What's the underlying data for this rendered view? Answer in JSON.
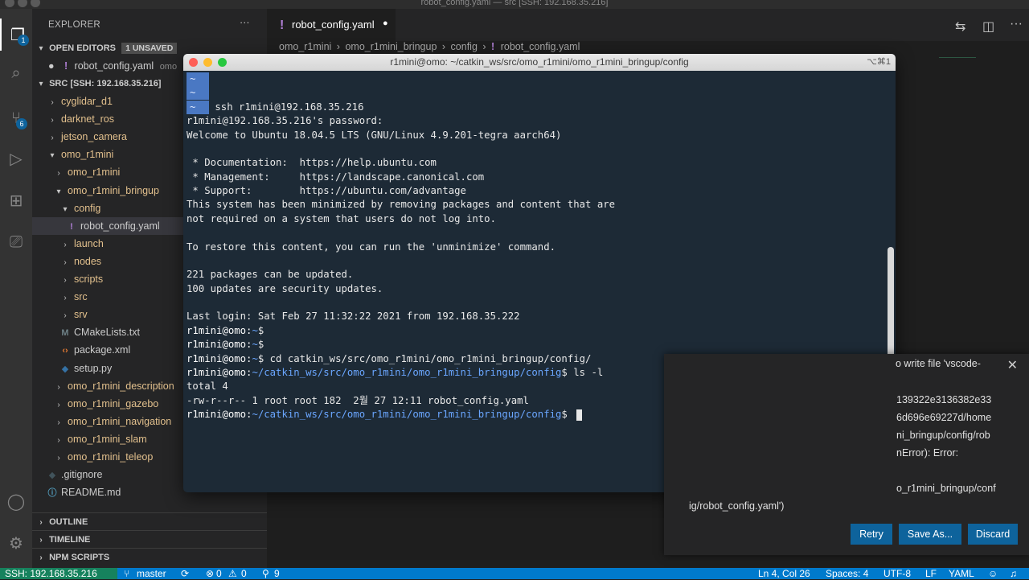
{
  "window_title": "robot_config.yaml — src [SSH: 192.168.35.216]",
  "explorer": {
    "title": "EXPLORER",
    "open_editors": {
      "label": "OPEN EDITORS",
      "badge": "1 UNSAVED",
      "file": "robot_config.yaml",
      "file_hint": "omo"
    },
    "workspace_label": "SRC [SSH: 192.168.35.216]",
    "tree": [
      {
        "label": "cyglidar_d1",
        "kind": "folder",
        "depth": 1,
        "open": false
      },
      {
        "label": "darknet_ros",
        "kind": "folder",
        "depth": 1,
        "open": false
      },
      {
        "label": "jetson_camera",
        "kind": "folder",
        "depth": 1,
        "open": false
      },
      {
        "label": "omo_r1mini",
        "kind": "folder",
        "depth": 1,
        "open": true
      },
      {
        "label": "omo_r1mini",
        "kind": "folder",
        "depth": 2,
        "open": false
      },
      {
        "label": "omo_r1mini_bringup",
        "kind": "folder",
        "depth": 2,
        "open": true
      },
      {
        "label": "config",
        "kind": "folder",
        "depth": 3,
        "open": true
      },
      {
        "label": "robot_config.yaml",
        "kind": "yaml",
        "depth": 4,
        "selected": true
      },
      {
        "label": "launch",
        "kind": "folder",
        "depth": 3,
        "open": false
      },
      {
        "label": "nodes",
        "kind": "folder",
        "depth": 3,
        "open": false
      },
      {
        "label": "scripts",
        "kind": "folder",
        "depth": 3,
        "open": false
      },
      {
        "label": "src",
        "kind": "folder",
        "depth": 3,
        "open": false
      },
      {
        "label": "srv",
        "kind": "folder",
        "depth": 3,
        "open": false
      },
      {
        "label": "CMakeLists.txt",
        "kind": "cmake",
        "depth": 3
      },
      {
        "label": "package.xml",
        "kind": "xml",
        "depth": 3
      },
      {
        "label": "setup.py",
        "kind": "py",
        "depth": 3
      },
      {
        "label": "omo_r1mini_description",
        "kind": "folder",
        "depth": 2,
        "open": false
      },
      {
        "label": "omo_r1mini_gazebo",
        "kind": "folder",
        "depth": 2,
        "open": false
      },
      {
        "label": "omo_r1mini_navigation",
        "kind": "folder",
        "depth": 2,
        "open": false
      },
      {
        "label": "omo_r1mini_slam",
        "kind": "folder",
        "depth": 2,
        "open": false
      },
      {
        "label": "omo_r1mini_teleop",
        "kind": "folder",
        "depth": 2,
        "open": false
      },
      {
        "label": ".gitignore",
        "kind": "git",
        "depth": 1
      },
      {
        "label": "README.md",
        "kind": "md",
        "depth": 1
      }
    ],
    "outline": "OUTLINE",
    "timeline": "TIMELINE",
    "npm_scripts": "NPM SCRIPTS"
  },
  "activity_badges": {
    "explorer": "1",
    "scm": "6"
  },
  "editor": {
    "tab_label": "robot_config.yaml",
    "breadcrumb": [
      "omo_r1mini",
      "omo_r1mini_bringup",
      "config",
      "robot_config.yaml"
    ]
  },
  "terminal": {
    "title": "r1mini@omo: ~/catkin_ws/src/omo_r1mini/omo_r1mini_bringup/config",
    "shortcut": "⌥⌘1",
    "lines": [
      {
        "type": "tilde",
        "text": ""
      },
      {
        "type": "tilde",
        "text": ""
      },
      {
        "type": "tilde",
        "text": " ssh r1mini@192.168.35.216"
      },
      {
        "type": "plain",
        "text": "r1mini@192.168.35.216's password:"
      },
      {
        "type": "plain",
        "text": "Welcome to Ubuntu 18.04.5 LTS (GNU/Linux 4.9.201-tegra aarch64)"
      },
      {
        "type": "plain",
        "text": ""
      },
      {
        "type": "plain",
        "text": " * Documentation:  https://help.ubuntu.com"
      },
      {
        "type": "plain",
        "text": " * Management:     https://landscape.canonical.com"
      },
      {
        "type": "plain",
        "text": " * Support:        https://ubuntu.com/advantage"
      },
      {
        "type": "plain",
        "text": "This system has been minimized by removing packages and content that are"
      },
      {
        "type": "plain",
        "text": "not required on a system that users do not log into."
      },
      {
        "type": "plain",
        "text": ""
      },
      {
        "type": "plain",
        "text": "To restore this content, you can run the 'unminimize' command."
      },
      {
        "type": "plain",
        "text": ""
      },
      {
        "type": "plain",
        "text": "221 packages can be updated."
      },
      {
        "type": "plain",
        "text": "100 updates are security updates."
      },
      {
        "type": "plain",
        "text": ""
      },
      {
        "type": "plain",
        "text": "Last login: Sat Feb 27 11:32:22 2021 from 192.168.35.222"
      },
      {
        "type": "prompt",
        "prompt": "r1mini@omo:",
        "path": "~",
        "cmd": "$"
      },
      {
        "type": "prompt",
        "prompt": "r1mini@omo:",
        "path": "~",
        "cmd": "$"
      },
      {
        "type": "prompt",
        "prompt": "r1mini@omo:",
        "path": "~",
        "cmd": "$ cd catkin_ws/src/omo_r1mini/omo_r1mini_bringup/config/"
      },
      {
        "type": "prompt",
        "prompt": "r1mini@omo:",
        "path": "~/catkin_ws/src/omo_r1mini/omo_r1mini_bringup/config",
        "cmd": "$ ls -l"
      },
      {
        "type": "plain",
        "text": "total 4"
      },
      {
        "type": "plain",
        "text": "-rw-r--r-- 1 root root 182  2월 27 12:11 robot_config.yaml"
      },
      {
        "type": "prompt",
        "prompt": "r1mini@omo:",
        "path": "~/catkin_ws/src/omo_r1mini/omo_r1mini_bringup/config",
        "cmd": "$ ",
        "cursor": true
      }
    ]
  },
  "notification": {
    "message_lines": [
      "o write file 'vscode-",
      "139322e3136382e33",
      "6d696e69227d/home",
      "ni_bringup/config/rob",
      "nError): Error:",
      "o_r1mini_bringup/conf",
      "ig/robot_config.yaml')"
    ],
    "buttons": {
      "retry": "Retry",
      "save_as": "Save As...",
      "discard": "Discard"
    }
  },
  "status_bar": {
    "remote": "SSH: 192.168.35.216",
    "branch": "master",
    "errors": "0",
    "warnings": "0",
    "ports": "9",
    "cursor": "Ln 4, Col 26",
    "spaces": "Spaces: 4",
    "encoding": "UTF-8",
    "eol": "LF",
    "language": "YAML"
  }
}
